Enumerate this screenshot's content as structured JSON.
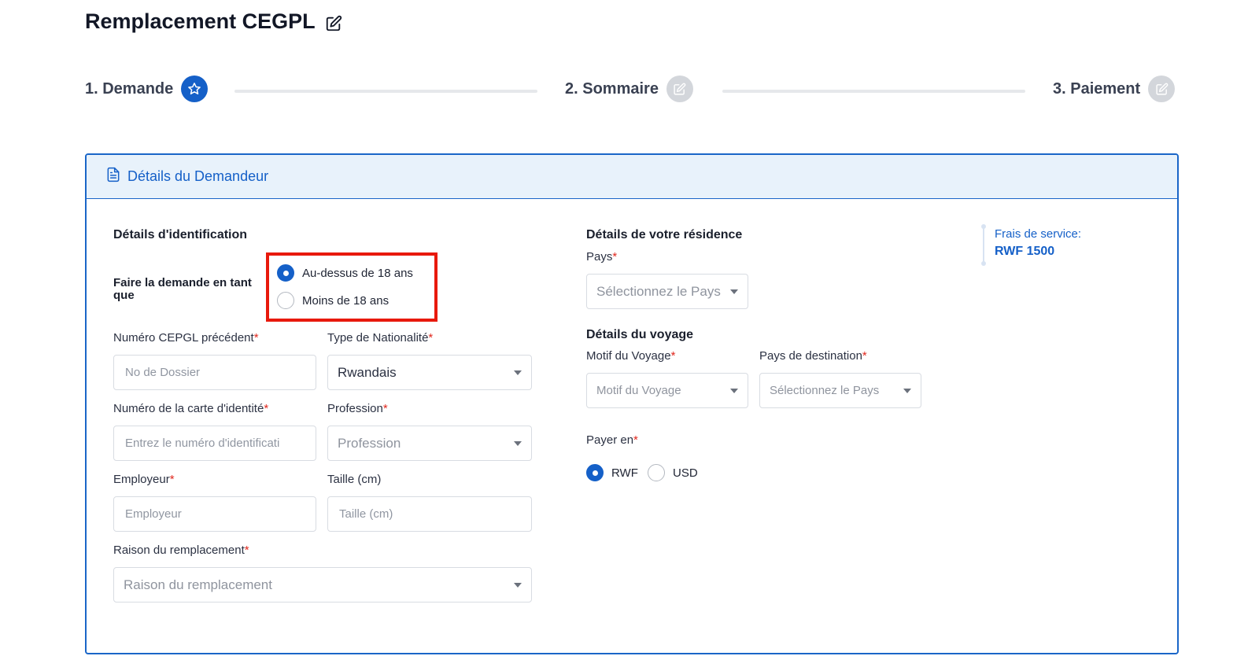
{
  "page": {
    "title": "Remplacement CEGPL"
  },
  "stepper": {
    "steps": [
      {
        "label": "1. Demande",
        "icon": "star-icon",
        "state": "active"
      },
      {
        "label": "2. Sommaire",
        "icon": "edit-icon",
        "state": "inactive"
      },
      {
        "label": "3. Paiement",
        "icon": "edit-icon",
        "state": "inactive"
      }
    ]
  },
  "card": {
    "header": "Détails du Demandeur"
  },
  "identification": {
    "title": "Détails d'identification",
    "applicant_type_label": "Faire la demande en tant que",
    "applicant_options": [
      {
        "label": "Au-dessus de 18 ans",
        "checked": true
      },
      {
        "label": "Moins de 18 ans",
        "checked": false
      }
    ],
    "previous_number": {
      "label": "Numéro CEPGL précédent",
      "placeholder": "No de Dossier"
    },
    "nationality": {
      "label": "Type de Nationalité",
      "value": "Rwandais"
    },
    "id_number": {
      "label": "Numéro de la carte d'identité",
      "placeholder": "Entrez le numéro d'identificati"
    },
    "profession": {
      "label": "Profession",
      "placeholder": "Profession"
    },
    "employer": {
      "label": "Employeur",
      "placeholder": "Employeur"
    },
    "height": {
      "label": "Taille (cm)",
      "placeholder": "Taille (cm)"
    },
    "replacement_reason": {
      "label": "Raison du remplacement",
      "placeholder": "Raison du remplacement"
    }
  },
  "residence": {
    "title": "Détails de votre résidence",
    "country": {
      "label": "Pays",
      "placeholder": "Sélectionnez le Pays"
    }
  },
  "travel": {
    "title": "Détails du voyage",
    "reason": {
      "label": "Motif du Voyage",
      "placeholder": "Motif du Voyage"
    },
    "destination": {
      "label": "Pays de destination",
      "placeholder": "Sélectionnez le Pays"
    }
  },
  "payment": {
    "label": "Payer en",
    "options": [
      {
        "label": "RWF",
        "checked": true
      },
      {
        "label": "USD",
        "checked": false
      }
    ]
  },
  "fees": {
    "label": "Frais de service:",
    "amount": "RWF 1500"
  },
  "colors": {
    "primary": "#1560c8",
    "highlight": "#e8190c",
    "required": "#e0281e"
  }
}
